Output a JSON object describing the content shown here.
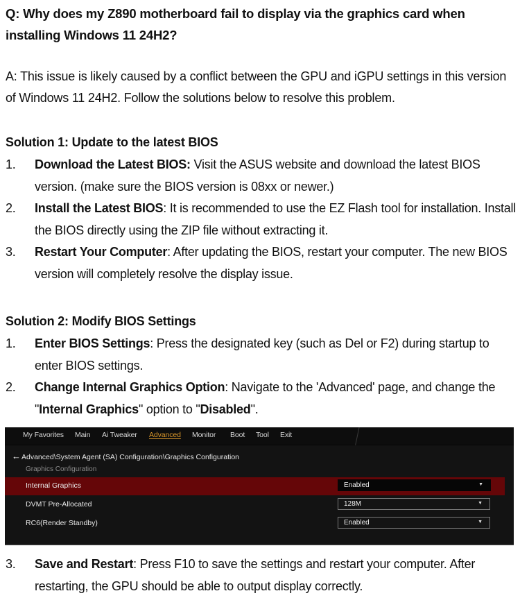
{
  "question": "Q: Why does my Z890 motherboard fail to display via the graphics card when installing Windows 11 24H2?",
  "answer": "A: This issue is likely caused by a conflict between the GPU and iGPU settings in this version of Windows 11 24H2. Follow the solutions below to resolve this problem.",
  "solution1": {
    "title": "Solution 1: Update to the latest BIOS",
    "steps": [
      {
        "num": "1.",
        "bold": "Download the Latest BIOS:",
        "text": " Visit the ASUS website and download the latest BIOS version. (make sure the BIOS version is 08xx or newer.)"
      },
      {
        "num": "2.",
        "bold": "Install the Latest BIOS",
        "text": ": It is recommended to use the EZ Flash tool for installation. Install the BIOS directly using the ZIP file without extracting it."
      },
      {
        "num": "3.",
        "bold": "Restart Your Computer",
        "text": ": After updating the BIOS, restart your computer. The new BIOS version will completely resolve the display issue."
      }
    ]
  },
  "solution2": {
    "title": "Solution 2: Modify BIOS Settings",
    "steps": [
      {
        "num": "1.",
        "bold": "Enter BIOS Settings",
        "text": ": Press the designated key (such as Del or F2) during startup to enter BIOS settings."
      },
      {
        "num": "2.",
        "bold": "Change Internal Graphics Option",
        "text_a": ": Navigate to the 'Advanced' page, and change the \"",
        "bold_b": "Internal Graphics",
        "text_b": "\" option to \"",
        "bold_c": "Disabled",
        "text_c": "\"."
      },
      {
        "num": "3.",
        "bold": "Save and Restart",
        "text": ": Press F10 to save the settings and restart your computer. After restarting, the GPU should be able to output display correctly."
      }
    ]
  },
  "bios": {
    "menu": [
      "My Favorites",
      "Main",
      "Ai Tweaker",
      "Advanced",
      "Monitor",
      "Boot",
      "Tool",
      "Exit"
    ],
    "active_menu": "Advanced",
    "back_icon": "arrow-left-icon",
    "path": "Advanced\\System Agent (SA) Configuration\\Graphics Configuration",
    "section": "Graphics Configuration",
    "rows": [
      {
        "label": "Internal Graphics",
        "value": "Enabled",
        "selected": true
      },
      {
        "label": "DVMT Pre-Allocated",
        "value": "128M",
        "selected": false
      },
      {
        "label": "RC6(Render Standby)",
        "value": "Enabled",
        "selected": false
      }
    ],
    "colors": {
      "active_menu": "#d9962a",
      "selected_row": "#650608",
      "background": "#131313"
    }
  }
}
